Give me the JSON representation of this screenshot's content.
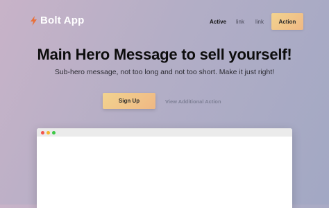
{
  "brand": {
    "name": "Bolt App",
    "icon": "bolt-icon"
  },
  "nav": {
    "links": [
      {
        "label": "Active",
        "active": true
      },
      {
        "label": "link",
        "active": false
      },
      {
        "label": "link",
        "active": false
      }
    ],
    "action_label": "Action"
  },
  "hero": {
    "title": "Main Hero Message to sell yourself!",
    "subtitle": "Sub-hero message, not too long and not too short. Make it just right!",
    "primary_label": "Sign Up",
    "secondary_label": "View Additional Action"
  },
  "colors": {
    "accent_start": "#f2d38f",
    "accent_end": "#efb884",
    "bolt": "#e8703a",
    "dot_red": "#f2564d",
    "dot_yellow": "#f5b72d",
    "dot_green": "#3cc947"
  }
}
